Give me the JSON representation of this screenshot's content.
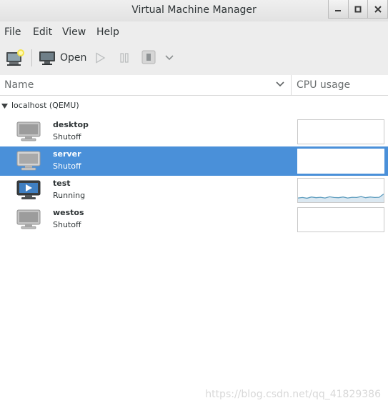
{
  "window": {
    "title": "Virtual Machine Manager"
  },
  "menu": [
    "File",
    "Edit",
    "View",
    "Help"
  ],
  "toolbar": {
    "open_label": "Open"
  },
  "columns": {
    "name": "Name",
    "cpu": "CPU usage"
  },
  "connection": {
    "label": "localhost (QEMU)"
  },
  "vms": [
    {
      "name": "desktop",
      "status": "Shutoff",
      "state": "shutoff"
    },
    {
      "name": "server",
      "status": "Shutoff",
      "state": "shutoff",
      "selected": true
    },
    {
      "name": "test",
      "status": "Running",
      "state": "running",
      "cpu_history": [
        0.18,
        0.2,
        0.17,
        0.22,
        0.19,
        0.21,
        0.18,
        0.23,
        0.2,
        0.19,
        0.22,
        0.18,
        0.21,
        0.2,
        0.24,
        0.19,
        0.22,
        0.2,
        0.21,
        0.35
      ]
    },
    {
      "name": "westos",
      "status": "Shutoff",
      "state": "shutoff"
    }
  ],
  "icons": [
    "new-vm-icon",
    "monitor-icon",
    "play-icon",
    "pause-icon",
    "stop-icon",
    "chevron-down-icon",
    "expander-icon",
    "vm-icon"
  ],
  "colors": {
    "selection": "#4a90d9",
    "graph_line": "#5b9bbd",
    "graph_fill": "#dbe8f1"
  },
  "watermark": "https://blog.csdn.net/qq_41829386"
}
